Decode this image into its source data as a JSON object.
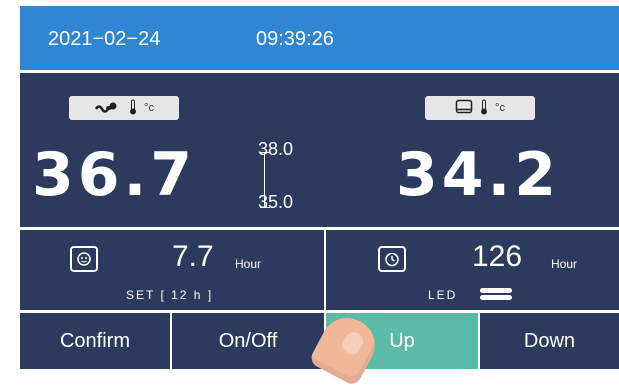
{
  "status_bar": {
    "date": "2021−02−24",
    "time": "09:39:26"
  },
  "left_panel": {
    "unit": "°c",
    "temperature": "36.7",
    "range_high": "38.0",
    "range_low": "35.0",
    "icons": [
      "baby-icon",
      "thermometer-icon"
    ]
  },
  "right_panel": {
    "unit": "°c",
    "temperature": "34.2",
    "icons": [
      "mattress-icon",
      "thermometer-icon"
    ]
  },
  "timer_left": {
    "value": "7.7",
    "unit": "Hour",
    "set_label": "SET [ 12 h ]",
    "icon": "baby-care-icon"
  },
  "timer_right": {
    "value": "126",
    "unit": "Hour",
    "label": "LED",
    "icon": "timer-icon"
  },
  "buttons": [
    {
      "label": "Confirm"
    },
    {
      "label": "On/Off"
    },
    {
      "label": "Up"
    },
    {
      "label": "Down"
    }
  ],
  "colors": {
    "status_bar": "#2f86d2",
    "panel": "#2c3a5e",
    "active_button": "#5bbba6"
  }
}
